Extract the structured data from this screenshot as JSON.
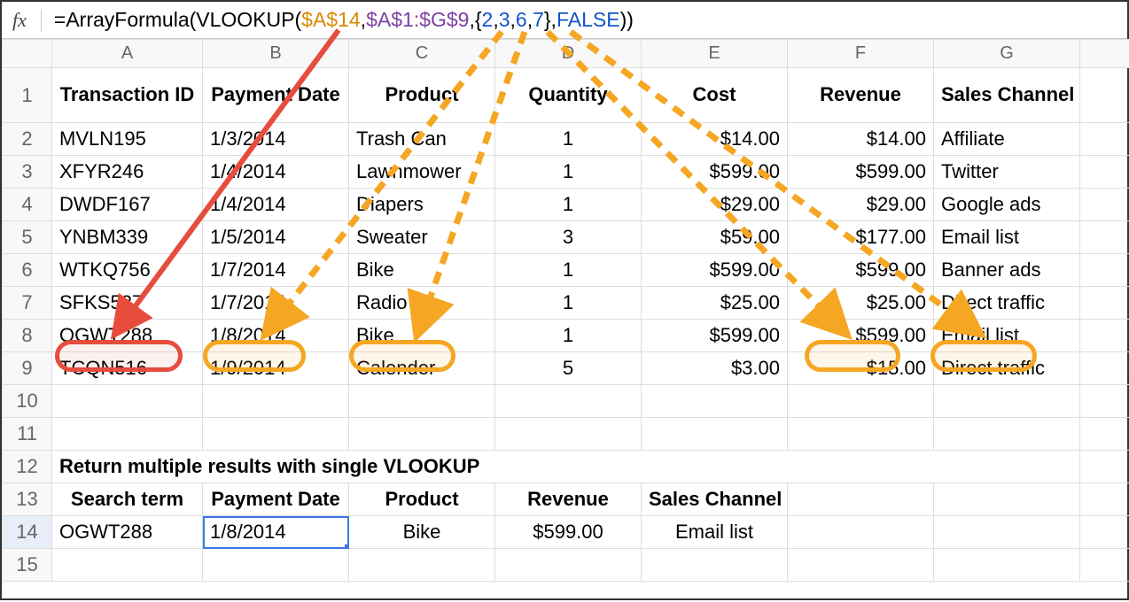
{
  "formula": {
    "prefix": "=ArrayFormula(VLOOKUP(",
    "ref1": "$A$14",
    "sep1": ",",
    "ref2": "$A$1:$G$9",
    "sep2": ",{",
    "n1": "2",
    "c1": ",",
    "n2": "3",
    "c2": ",",
    "n3": "6",
    "c3": ",",
    "n4": "7",
    "sep3": "},",
    "kw": "FALSE",
    "suffix": "))"
  },
  "columns": [
    "A",
    "B",
    "C",
    "D",
    "E",
    "F",
    "G"
  ],
  "headers": {
    "A": "Transaction ID",
    "B": "Payment Date",
    "C": "Product",
    "D": "Quantity",
    "E": "Cost",
    "F": "Revenue",
    "G": "Sales Channel"
  },
  "rows": [
    {
      "n": "2",
      "A": "MVLN195",
      "B": "1/3/2014",
      "C": "Trash Can",
      "D": "1",
      "E": "$14.00",
      "F": "$14.00",
      "G": "Affiliate"
    },
    {
      "n": "3",
      "A": "XFYR246",
      "B": "1/4/2014",
      "C": "Lawnmower",
      "D": "1",
      "E": "$599.00",
      "F": "$599.00",
      "G": "Twitter"
    },
    {
      "n": "4",
      "A": "DWDF167",
      "B": "1/4/2014",
      "C": "Diapers",
      "D": "1",
      "E": "$29.00",
      "F": "$29.00",
      "G": "Google ads"
    },
    {
      "n": "5",
      "A": "YNBM339",
      "B": "1/5/2014",
      "C": "Sweater",
      "D": "3",
      "E": "$59.00",
      "F": "$177.00",
      "G": "Email list"
    },
    {
      "n": "6",
      "A": "WTKQ756",
      "B": "1/7/2014",
      "C": "Bike",
      "D": "1",
      "E": "$599.00",
      "F": "$599.00",
      "G": "Banner ads"
    },
    {
      "n": "7",
      "A": "SFKS527",
      "B": "1/7/2014",
      "C": "Radio",
      "D": "1",
      "E": "$25.00",
      "F": "$25.00",
      "G": "Direct traffic"
    },
    {
      "n": "8",
      "A": "OGWT288",
      "B": "1/8/2014",
      "C": "Bike",
      "D": "1",
      "E": "$599.00",
      "F": "$599.00",
      "G": "Email list"
    },
    {
      "n": "9",
      "A": "TCQN516",
      "B": "1/9/2014",
      "C": "Calender",
      "D": "5",
      "E": "$3.00",
      "F": "$15.00",
      "G": "Direct traffic"
    }
  ],
  "section_title": "Return multiple results with single VLOOKUP",
  "headers2": {
    "A": "Search term",
    "B": "Payment Date",
    "C": "Product",
    "D": "Revenue",
    "E": "Sales Channel"
  },
  "result_row": {
    "n": "14",
    "A": "OGWT288",
    "B": "1/8/2014",
    "C": "Bike",
    "D": "$599.00",
    "E": "Email list"
  },
  "rownums": {
    "r10": "10",
    "r11": "11",
    "r12": "12",
    "r13": "13",
    "r15": "15",
    "r1": "1"
  }
}
